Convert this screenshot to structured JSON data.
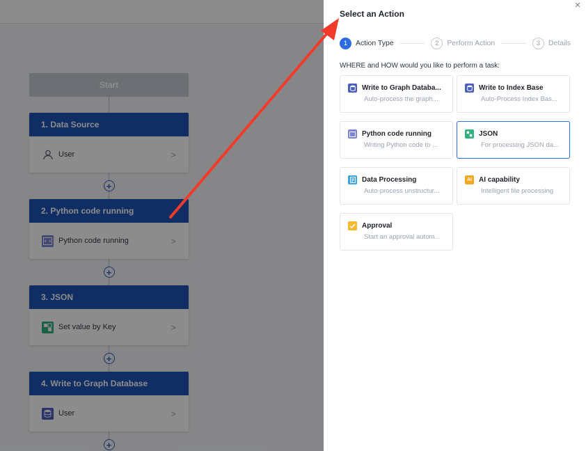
{
  "workflow": {
    "start_label": "Start",
    "steps": [
      {
        "title": "1. Data Source",
        "item": "User",
        "icon": "user-icon"
      },
      {
        "title": "2. Python code running",
        "item": "Python code running",
        "icon": "python-code-icon"
      },
      {
        "title": "3. JSON",
        "item": "Set value by Key",
        "icon": "json-icon"
      },
      {
        "title": "4. Write to Graph Database",
        "item": "User",
        "icon": "database-icon"
      }
    ],
    "chevron": ">",
    "add_symbol": "+"
  },
  "drawer": {
    "title": "Select an Action",
    "close_symbol": "×",
    "steps": [
      {
        "num": "1",
        "label": "Action Type"
      },
      {
        "num": "2",
        "label": "Perform Action"
      },
      {
        "num": "3",
        "label": "Details"
      }
    ],
    "prompt": "WHERE and HOW would you like to perform a task:",
    "cards": [
      {
        "title": "Write to Graph Databa...",
        "desc": "Auto-process the graph...",
        "icon": "database-icon",
        "color": "#4a5fc1"
      },
      {
        "title": "Write to Index Base",
        "desc": "Auto-Process Index Bas...",
        "icon": "database-icon",
        "color": "#4a5fc1"
      },
      {
        "title": "Python code running",
        "desc": "Writing Python code to ...",
        "icon": "python-code-icon",
        "color": "#7b83d6"
      },
      {
        "title": "JSON",
        "desc": "For processing JSON da...",
        "icon": "json-icon",
        "color": "#2fb07c"
      },
      {
        "title": "Data Processing",
        "desc": "Auto-process unstructur...",
        "icon": "data-processing-icon",
        "color": "#3aa3e0"
      },
      {
        "title": "AI capability",
        "desc": "Intelligent file processing",
        "icon": "ai-icon",
        "color": "#f5a623"
      },
      {
        "title": "Approval",
        "desc": "Start an approval autom...",
        "icon": "approval-icon",
        "color": "#f5b82e"
      }
    ]
  },
  "colors": {
    "primary": "#1e54b7",
    "accent": "#2f6be0",
    "annotation": "#f23b2a"
  }
}
